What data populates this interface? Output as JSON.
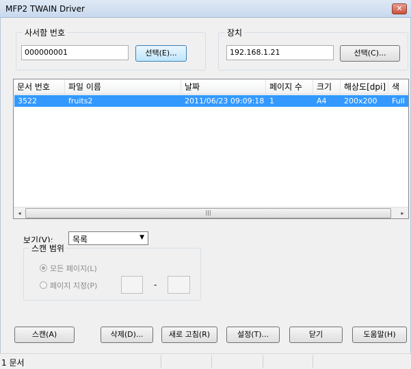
{
  "window": {
    "title": "MFP2 TWAIN Driver",
    "close_glyph": "✕"
  },
  "mailbox": {
    "group_label": "사서함 번호",
    "value": "000000001",
    "select_button": "선택(E)..."
  },
  "device": {
    "group_label": "장치",
    "value": "192.168.1.21",
    "select_button": "선택(C)..."
  },
  "document_list": {
    "columns": [
      "문서 번호",
      "파일 이름",
      "날짜",
      "페이지 수",
      "크기",
      "해상도[dpi]",
      "색"
    ],
    "rows": [
      {
        "doc_number": "3522",
        "file_name": "fruits2",
        "date": "2011/06/23 09:09:18",
        "pages": "1",
        "size": "A4",
        "resolution": "200x200",
        "color": "Full"
      }
    ],
    "scroll_left": "◂",
    "scroll_right": "▸",
    "scroll_grip": "|||"
  },
  "view": {
    "label": "보기(V):",
    "selected": "목록",
    "arrow": "▼"
  },
  "scan_range": {
    "group_label": "스캔 범위",
    "all_pages": "모든 페이지(L)",
    "page_range": "페이지 지정(P)",
    "separator": "-",
    "from_value": "",
    "to_value": ""
  },
  "buttons": {
    "scan": "스캔(A)",
    "delete": "삭제(D)...",
    "refresh": "새로 고침(R)",
    "settings": "설정(T)...",
    "close": "닫기",
    "help": "도움말(H)"
  },
  "status": {
    "text": "1 문서"
  },
  "colors": {
    "selection": "#3399ff",
    "titlebar": "#c8d9ee",
    "close_button": "#c9503a"
  }
}
